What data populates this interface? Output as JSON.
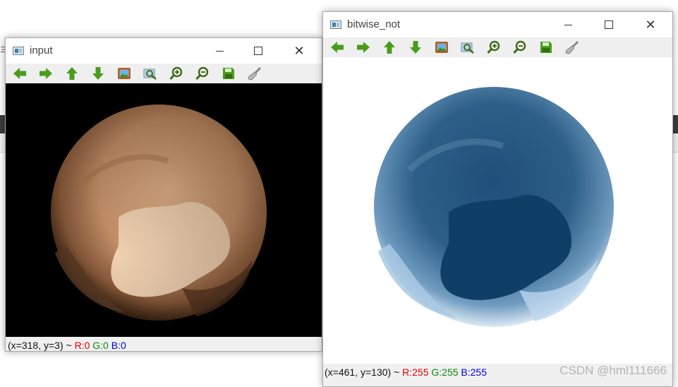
{
  "windows": [
    {
      "title": "input",
      "status": {
        "prefix": "(x=318, y=3) ~ ",
        "r": "R:0",
        "g": "G:0",
        "b": "B:0"
      },
      "canvas_bg": "#000000"
    },
    {
      "title": "bitwise_not",
      "status": {
        "prefix": "(x=461, y=130) ~ ",
        "r": "R:255",
        "g": "G:255",
        "b": "B:255"
      },
      "canvas_bg": "#ffffff"
    }
  ],
  "toolbar_icons": [
    "arrow-left-icon",
    "arrow-right-icon",
    "arrow-up-icon",
    "arrow-down-icon",
    "image-icon",
    "zoom-region-icon",
    "zoom-in-icon",
    "zoom-out-icon",
    "save-icon",
    "properties-brush-icon"
  ],
  "colors": {
    "status_r": "#e00000",
    "status_g": "#0a8a0a",
    "status_b": "#0000e0",
    "toolbar_green": "#4a9c1b"
  },
  "desktop": {
    "glyph": "三"
  },
  "watermark": "CSDN @hml111666"
}
